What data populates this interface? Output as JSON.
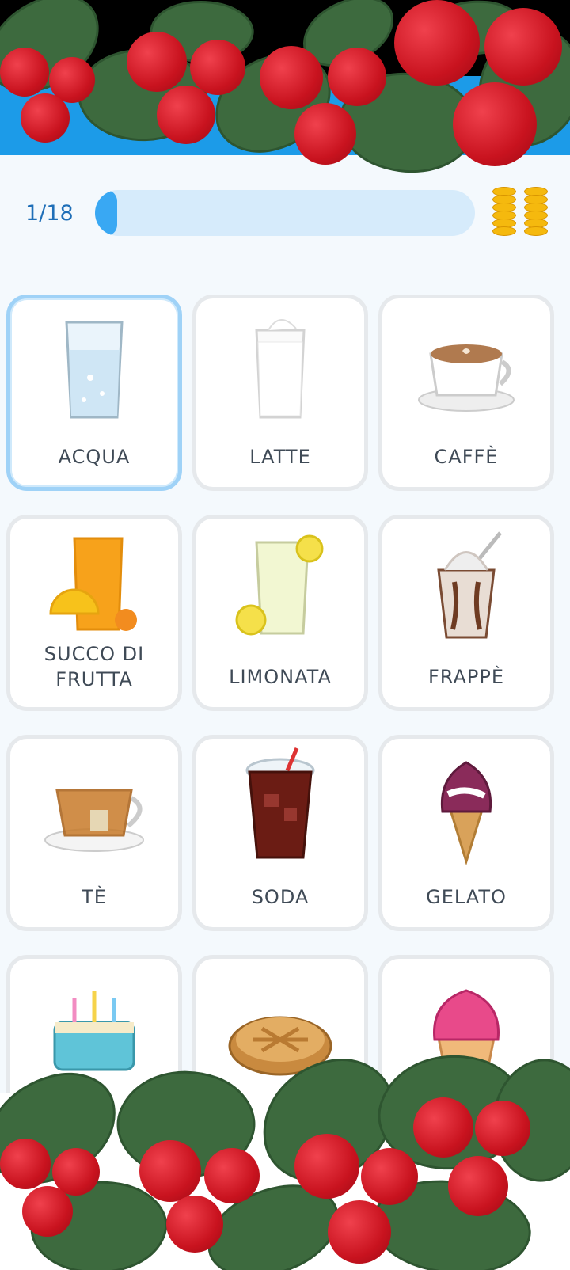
{
  "progress": {
    "counter": "1/18",
    "fraction": 0.0556
  },
  "cards": [
    {
      "label": "ACQUA",
      "icon": "water-glass-icon",
      "selected": true
    },
    {
      "label": "LATTE",
      "icon": "milk-glass-icon",
      "selected": false
    },
    {
      "label": "CAFFÈ",
      "icon": "coffee-cup-icon",
      "selected": false
    },
    {
      "label": "SUCCO DI FRUTTA",
      "icon": "juice-glass-icon",
      "selected": false
    },
    {
      "label": "LIMONATA",
      "icon": "lemonade-glass-icon",
      "selected": false
    },
    {
      "label": "FRAPPÈ",
      "icon": "milkshake-icon",
      "selected": false
    },
    {
      "label": "TÈ",
      "icon": "tea-cup-icon",
      "selected": false
    },
    {
      "label": "SODA",
      "icon": "soda-cup-icon",
      "selected": false
    },
    {
      "label": "GELATO",
      "icon": "ice-cream-cone-icon",
      "selected": false
    },
    {
      "label": "",
      "icon": "birthday-cake-icon",
      "selected": false
    },
    {
      "label": "",
      "icon": "pie-icon",
      "selected": false
    },
    {
      "label": "",
      "icon": "cupcake-icon",
      "selected": false
    }
  ],
  "colors": {
    "accent": "#39a8f3",
    "header": "#1c9be8",
    "card_border": "#e6e9ec",
    "selected_border": "#9fd2f7"
  }
}
